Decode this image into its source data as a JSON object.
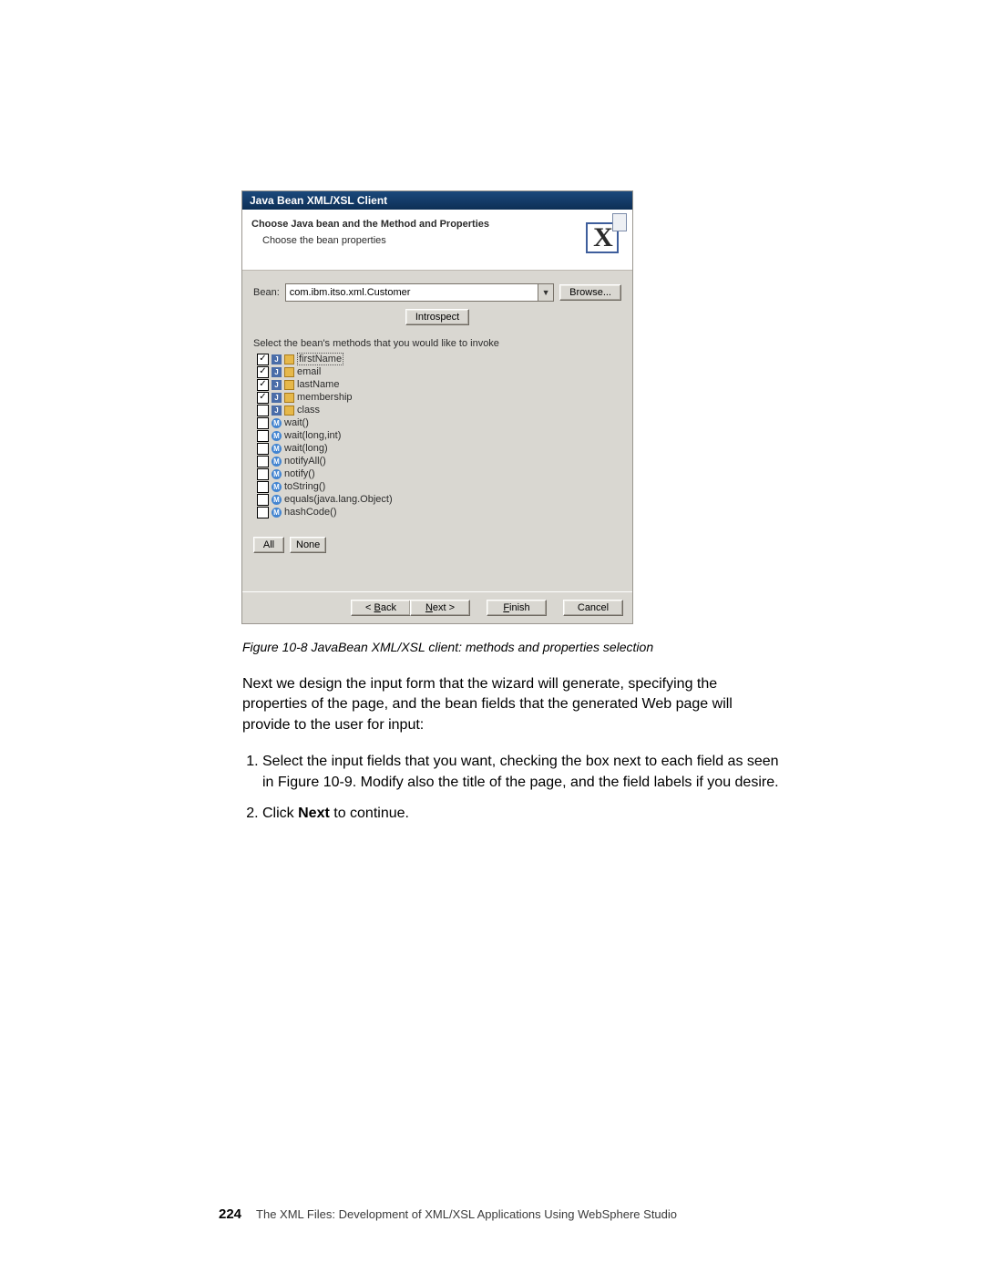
{
  "dialog": {
    "title": "Java Bean XML/XSL Client",
    "heading": "Choose Java bean and the Method and Properties",
    "sub": "Choose the bean properties",
    "beanLabel": "Bean:",
    "beanValue": "com.ibm.itso.xml.Customer",
    "browse": "Browse...",
    "introspect": "Introspect",
    "selectLabel": "Select the bean's methods that you would like to invoke",
    "items": [
      {
        "checked": true,
        "kind": "prop",
        "label": "firstName",
        "selected": true
      },
      {
        "checked": true,
        "kind": "prop",
        "label": "email"
      },
      {
        "checked": true,
        "kind": "prop",
        "label": "lastName"
      },
      {
        "checked": true,
        "kind": "prop",
        "label": "membership"
      },
      {
        "checked": false,
        "kind": "prop",
        "label": "class"
      },
      {
        "checked": false,
        "kind": "method",
        "label": "wait()"
      },
      {
        "checked": false,
        "kind": "method",
        "label": "wait(long,int)"
      },
      {
        "checked": false,
        "kind": "method",
        "label": "wait(long)"
      },
      {
        "checked": false,
        "kind": "method",
        "label": "notifyAll()"
      },
      {
        "checked": false,
        "kind": "method",
        "label": "notify()"
      },
      {
        "checked": false,
        "kind": "method",
        "label": "toString()"
      },
      {
        "checked": false,
        "kind": "method",
        "label": "equals(java.lang.Object)"
      },
      {
        "checked": false,
        "kind": "method",
        "label": "hashCode()"
      }
    ],
    "all": "All",
    "none": "None",
    "back": "Back",
    "next": "Next >",
    "finish": "Finish",
    "cancel": "Cancel"
  },
  "doc": {
    "caption": "Figure 10-8   JavaBean XML/XSL client: methods and properties selection",
    "para": "Next we design the input form that the wizard will generate, specifying the properties of the page, and the bean fields that the generated Web page will provide to the user for input:",
    "step1": "Select the input fields that you want, checking the box next to each field as seen in Figure 10-9. Modify also the title of the page, and the field labels if you desire.",
    "step2a": "Click ",
    "step2b": "Next",
    "step2c": " to continue.",
    "pageNo": "224",
    "footer": "The XML Files:   Development of XML/XSL Applications Using WebSphere Studio"
  }
}
